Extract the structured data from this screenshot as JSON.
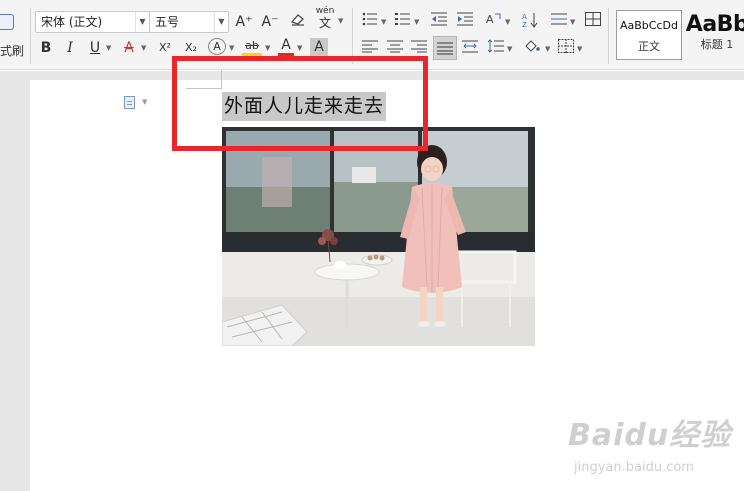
{
  "ribbon": {
    "format_painter_label": "式刷",
    "font_name": "宋体 (正文)",
    "font_size": "五号",
    "grow_font": "A⁺",
    "shrink_font": "A⁻",
    "phonetic_top": "wén",
    "phonetic_char": "文",
    "bold": "B",
    "italic": "I",
    "underline": "U",
    "strikethrough": "A",
    "superscript": "X²",
    "subscript": "X₂",
    "text_effect": "A",
    "highlight": "ab",
    "font_color": "A",
    "char_shading": "A",
    "sort": "A↓Z",
    "styles": [
      {
        "sample": "AaBbCcDd",
        "name": "正文"
      },
      {
        "sample": "AaBb",
        "name": "标题 1"
      }
    ]
  },
  "document": {
    "heading_text": "外面人儿走来走去",
    "image_alt": "穿粉色长衬衫的小女孩站在窗边"
  },
  "watermark": {
    "brand": "Baidu经验",
    "url": "jingyan.baidu.com"
  },
  "colors": {
    "highlight_box": "#e8262b",
    "selection": "#c8c8c8",
    "accent": "#4472c4"
  }
}
